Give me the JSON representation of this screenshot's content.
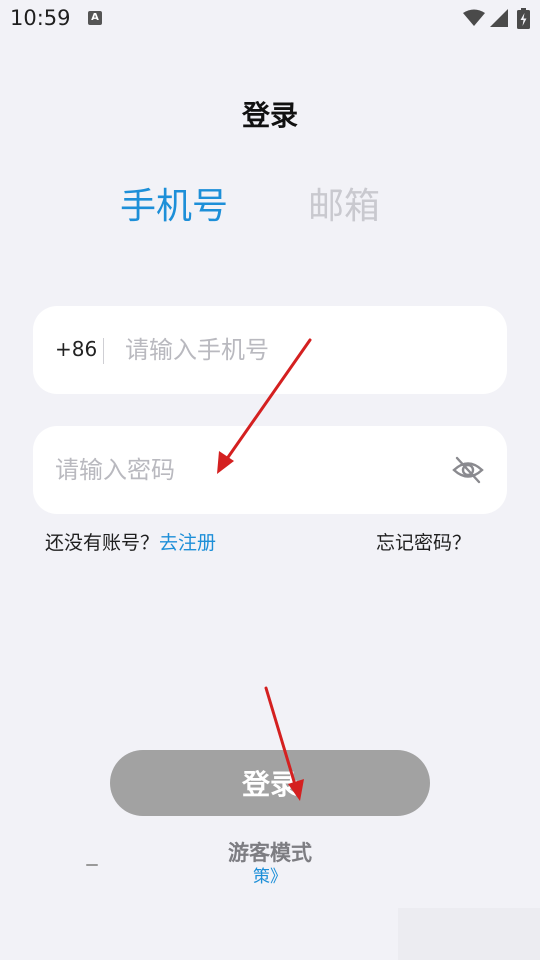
{
  "status_bar": {
    "time": "10:59",
    "notification_glyph": "A",
    "icons": [
      "wifi-icon",
      "signal-icon",
      "battery-charging-icon"
    ]
  },
  "page": {
    "title": "登录"
  },
  "tabs": [
    {
      "label": "手机号",
      "active": true
    },
    {
      "label": "邮箱",
      "active": false
    }
  ],
  "phone_field": {
    "country_code": "+86",
    "value": "",
    "placeholder": "请输入手机号"
  },
  "password_field": {
    "value": "",
    "placeholder": "请输入密码",
    "toggle_icon": "eye-off-icon"
  },
  "links": {
    "no_account": "还没有账号？",
    "register": "去注册",
    "forgot_password": "忘记密码？"
  },
  "login_button": {
    "label": "登录"
  },
  "guest": {
    "label": "游客模式",
    "sub": "策》"
  },
  "colors": {
    "accent": "#1d8fd8",
    "background": "#f2f2f7",
    "button_disabled": "#a2a2a2",
    "annotation_arrow": "#d42020"
  }
}
